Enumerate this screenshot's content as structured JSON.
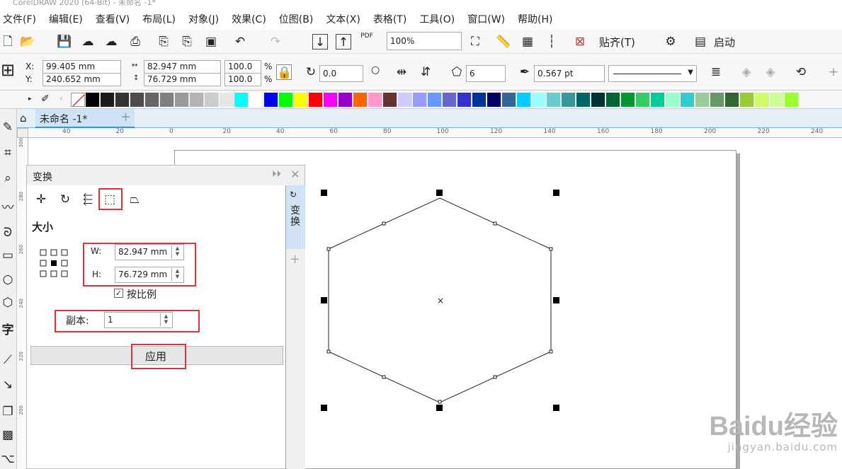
{
  "window": {
    "title": "CorelDRAW 2020 (64-Bit) - 未命名 -1*"
  },
  "menu": [
    "文件(F)",
    "编辑(E)",
    "查看(V)",
    "布局(L)",
    "对象(J)",
    "效果(C)",
    "位图(B)",
    "文本(X)",
    "表格(T)",
    "工具(O)",
    "窗口(W)",
    "帮助(H)"
  ],
  "toolbar": {
    "zoom": "100%",
    "snap_label": "贴齐(T)",
    "launch_label": "启动",
    "pdf_label": "PDF"
  },
  "propbar": {
    "x_label": "X:",
    "y_label": "Y:",
    "x_value": "99.405 mm",
    "y_value": "240.652 mm",
    "w_value": "82.947 mm",
    "h_value": "76.729 mm",
    "scale_w": "100.0",
    "scale_h": "100.0",
    "percent": "%",
    "rotation": "0.0",
    "sides": "6",
    "outline_width": "0.567 pt"
  },
  "doc": {
    "tab_label": "未命名 -1*",
    "add_tab": "+"
  },
  "ruler": {
    "h_ticks": [
      "40",
      "20",
      "0",
      "20",
      "40",
      "60",
      "80",
      "100",
      "120",
      "140",
      "160",
      "180",
      "200",
      "220",
      "240"
    ],
    "v_ticks": [
      "300",
      "280",
      "260",
      "240",
      "220",
      "200"
    ]
  },
  "docker": {
    "title": "变换",
    "section": "大小",
    "w_label": "W:",
    "h_label": "H:",
    "w_value": "82.947 mm",
    "h_value": "76.729 mm",
    "proportional_label": "按比例",
    "copies_label": "副本:",
    "copies_value": "1",
    "apply_label": "应用",
    "side_tab_label": "变换"
  },
  "watermark": {
    "brand": "Baidu经验",
    "url": "jingyan.baidu.com"
  },
  "colors": {
    "palette": [
      "#000000",
      "#1a1a1a",
      "#333333",
      "#4d4d4d",
      "#666666",
      "#808080",
      "#999999",
      "#b3b3b3",
      "#cccccc",
      "#e6e6e6",
      "#00ffff",
      "#ffffff",
      "#0000ff",
      "#00ff00",
      "#ffff00",
      "#ff0000",
      "#ff00ff",
      "#9900cc",
      "#ff6600",
      "#ff99cc",
      "#663333",
      "#ccccff",
      "#9999ff",
      "#6699ff",
      "#6666cc",
      "#3333cc",
      "#003399",
      "#000066",
      "#336699",
      "#00ccff",
      "#99ffff",
      "#66cccc",
      "#339999",
      "#006666",
      "#003333",
      "#006633",
      "#009933",
      "#33cc66",
      "#00cc99",
      "#99ffcc",
      "#33cccc",
      "#99cc99",
      "#669966",
      "#336633",
      "#99cc33",
      "#ccff66",
      "#ccff99",
      "#99ff33"
    ],
    "highlight": "#dd3333",
    "accent": "#2e9bd6"
  }
}
